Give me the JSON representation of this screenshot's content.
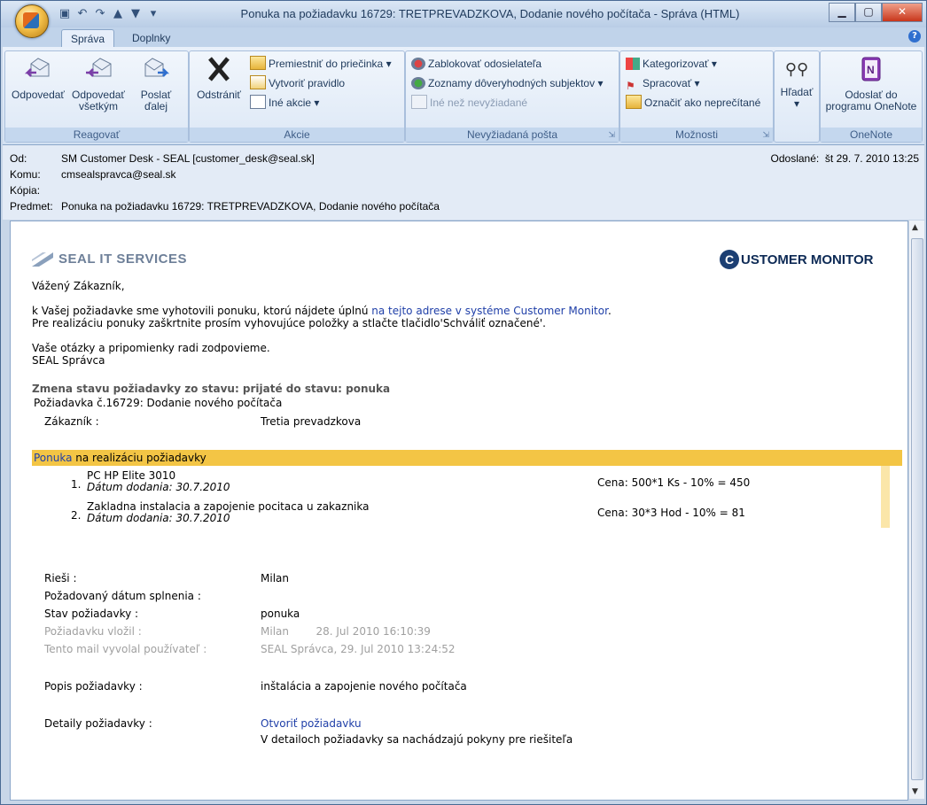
{
  "window": {
    "title": "Ponuka na požiadavku 16729: TRETPREVADZKOVA, Dodanie nového  počítača - Správa (HTML)"
  },
  "tabs": [
    {
      "label": "Správa"
    },
    {
      "label": "Doplnky"
    }
  ],
  "ribbon": {
    "groups": {
      "reagovat": "Reagovať",
      "akcie": "Akcie",
      "nevyziadana": "Nevyžiadaná pošta",
      "moznosti": "Možnosti",
      "onenote": "OneNote"
    },
    "reply_label_1": "Odpovedať",
    "reply_all_label_1": "Odpovedať",
    "reply_all_label_2": "všetkým",
    "forward_label_1": "Poslať",
    "forward_label_2": "ďalej",
    "delete_label": "Odstrániť",
    "move_label": "Premiestniť do priečinka",
    "rule_label": "Vytvoriť pravidlo",
    "other_label": "Iné akcie",
    "block_label": "Zablokovať odosielateľa",
    "safe_label": "Zoznamy dôveryhodných subjektov",
    "notjunk_label": "Iné než nevyžiadané",
    "categorize_label": "Kategorizovať",
    "followup_label": "Spracovať",
    "unread_label": "Označiť ako neprečítané",
    "find_label": "Hľadať",
    "onenote_label_1": "Odoslať do",
    "onenote_label_2": "programu OneNote"
  },
  "header": {
    "from_label": "Od:",
    "from_value": "SM Customer Desk - SEAL [customer_desk@seal.sk]",
    "to_label": "Komu:",
    "to_value": "cmsealspravca@seal.sk",
    "cc_label": "Kópia:",
    "cc_value": "",
    "subject_label": "Predmet:",
    "subject_value": "Ponuka na požiadavku 16729: TRETPREVADZKOVA, Dodanie nového  počítača",
    "sent_label": "Odoslané:",
    "sent_value": "št 29. 7. 2010 13:25"
  },
  "body": {
    "seal_logo": "SEAL IT SERVICES",
    "cm_logo_c": "C",
    "cm_logo": "USTOMER MONITOR",
    "greeting": "Vážený Zákazník,",
    "p1_a": "k Vašej požiadavke sme vyhotovili ponuku, ktorú nájdete úplnú ",
    "p1_link": "na tejto adrese v systéme Customer Monitor",
    "p1_b": ".",
    "p2": "Pre realizáciu ponuky zaškrtnite prosím vyhovujúce položky a stlačte tlačidlo'Schváliť označené'.",
    "p3": "Vaše otázky a pripomienky radi zodpovieme.",
    "p4": "SEAL Správca",
    "status_change": "Zmena stavu požiadavky zo stavu: prijaté do stavu: ponuka",
    "request_line": "Požiadavka č.16729:  Dodanie nového počítača",
    "customer_label": "Zákazník :",
    "customer_value": "Tretia prevadzkova",
    "bar_link": "Ponuka",
    "bar_text": " na realizáciu požiadavky",
    "items": [
      {
        "num": "1.",
        "name": "PC HP Elite 3010",
        "date": "Dátum dodania: 30.7.2010",
        "price": "Cena: 500*1 Ks - 10% = 450"
      },
      {
        "num": "2.",
        "name": "Zakladna instalacia a zapojenie pocitaca u zakaznika",
        "date": "Dátum dodania: 30.7.2010",
        "price": "Cena: 30*3 Hod - 10% = 81"
      }
    ],
    "solver_label": "Rieši :",
    "solver_value": "Milan",
    "due_label": "Požadovaný dátum splnenia :",
    "state_label": "Stav požiadavky :",
    "state_value": "ponuka",
    "inserted_label": "Požiadavku vložil :",
    "inserted_value": "Milan        28. Jul 2010 16:10:39",
    "triggered_label": "Tento mail vyvolal používateľ :",
    "triggered_value": "SEAL Správca, 29. Jul 2010 13:24:52",
    "desc_label": "Popis požiadavky :",
    "desc_value": "inštalácia a zapojenie nového počítača",
    "details_label": "Detaily požiadavky :",
    "details_link": "Otvoriť požiadavku",
    "details_note": "V detailoch požiadavky sa nachádzajú pokyny pre riešiteľa"
  }
}
